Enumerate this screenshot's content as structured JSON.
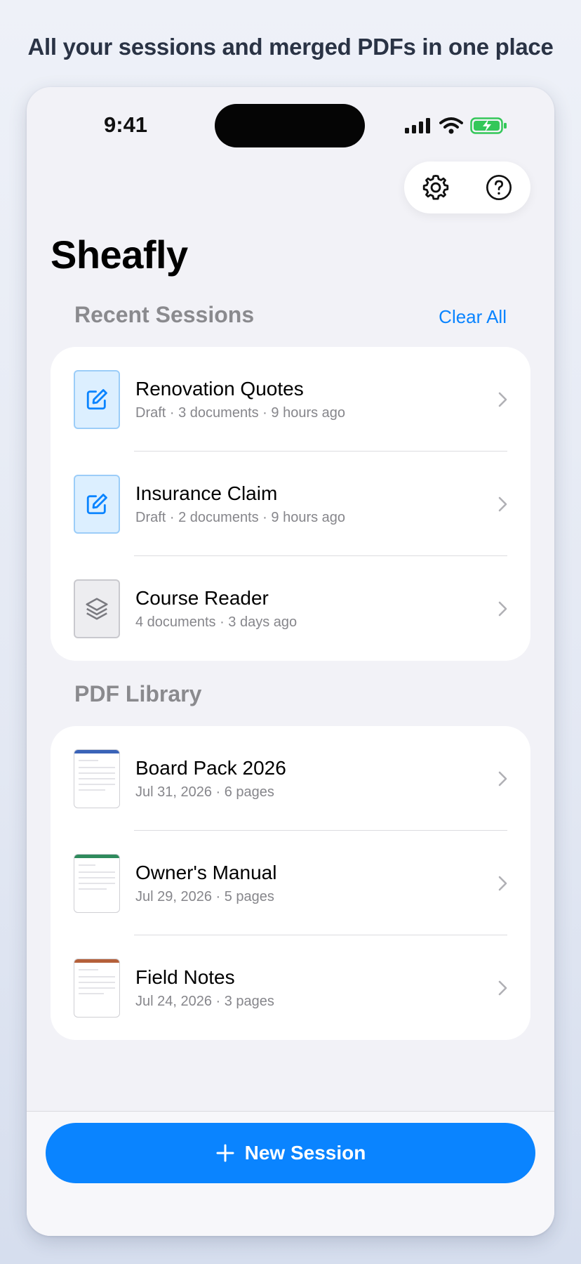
{
  "headline": "All your sessions and merged PDFs in one place",
  "status_bar": {
    "time": "9:41"
  },
  "app": {
    "title": "Sheafly"
  },
  "recent": {
    "title": "Recent Sessions",
    "clear_label": "Clear All",
    "items": [
      {
        "title": "Renovation Quotes",
        "subtitle": "Draft · 3 documents · 9 hours ago",
        "icon": "edit-icon"
      },
      {
        "title": "Insurance Claim",
        "subtitle": "Draft · 2 documents · 9 hours ago",
        "icon": "edit-icon"
      },
      {
        "title": "Course Reader",
        "subtitle": "4 documents · 3 days ago",
        "icon": "layers-icon"
      }
    ]
  },
  "library": {
    "title": "PDF Library",
    "items": [
      {
        "title": "Board Pack 2026",
        "subtitle": "Jul 31, 2026 · 6 pages",
        "accent": "#3a63b8"
      },
      {
        "title": "Owner's Manual",
        "subtitle": "Jul 29, 2026 · 5 pages",
        "accent": "#2e8a5c"
      },
      {
        "title": "Field Notes",
        "subtitle": "Jul 24, 2026 · 3 pages",
        "accent": "#b5603a"
      }
    ]
  },
  "actions": {
    "new_session_label": "New Session"
  },
  "colors": {
    "accent": "#0a84ff",
    "battery": "#34c759"
  }
}
